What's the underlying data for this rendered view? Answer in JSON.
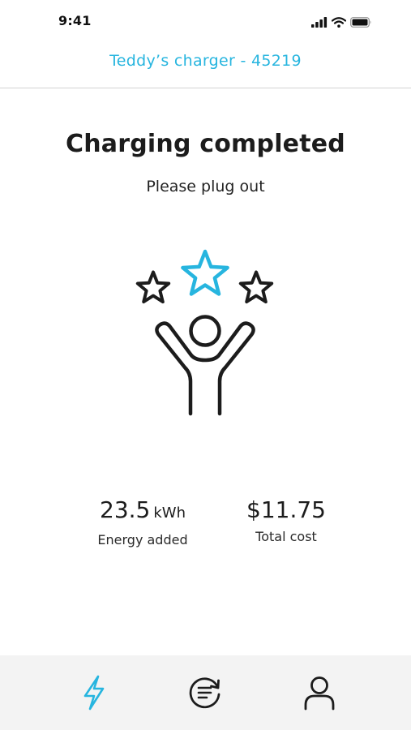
{
  "status_bar": {
    "time": "9:41"
  },
  "header": {
    "title": "Teddy’s charger - 45219"
  },
  "main": {
    "headline": "Charging completed",
    "subline": "Please plug out"
  },
  "stats": {
    "energy": {
      "value": "23.5",
      "unit": "kWh",
      "label": "Energy added"
    },
    "cost": {
      "value": "$11.75",
      "label": "Total cost"
    }
  },
  "tabs": [
    {
      "icon": "lightning-icon",
      "active": true
    },
    {
      "icon": "history-icon",
      "active": false
    },
    {
      "icon": "profile-icon",
      "active": false
    }
  ],
  "colors": {
    "accent": "#27b5df",
    "text": "#1c1c1c",
    "tab_bar_bg": "#f3f3f3",
    "divider": "#d3d3d3"
  }
}
